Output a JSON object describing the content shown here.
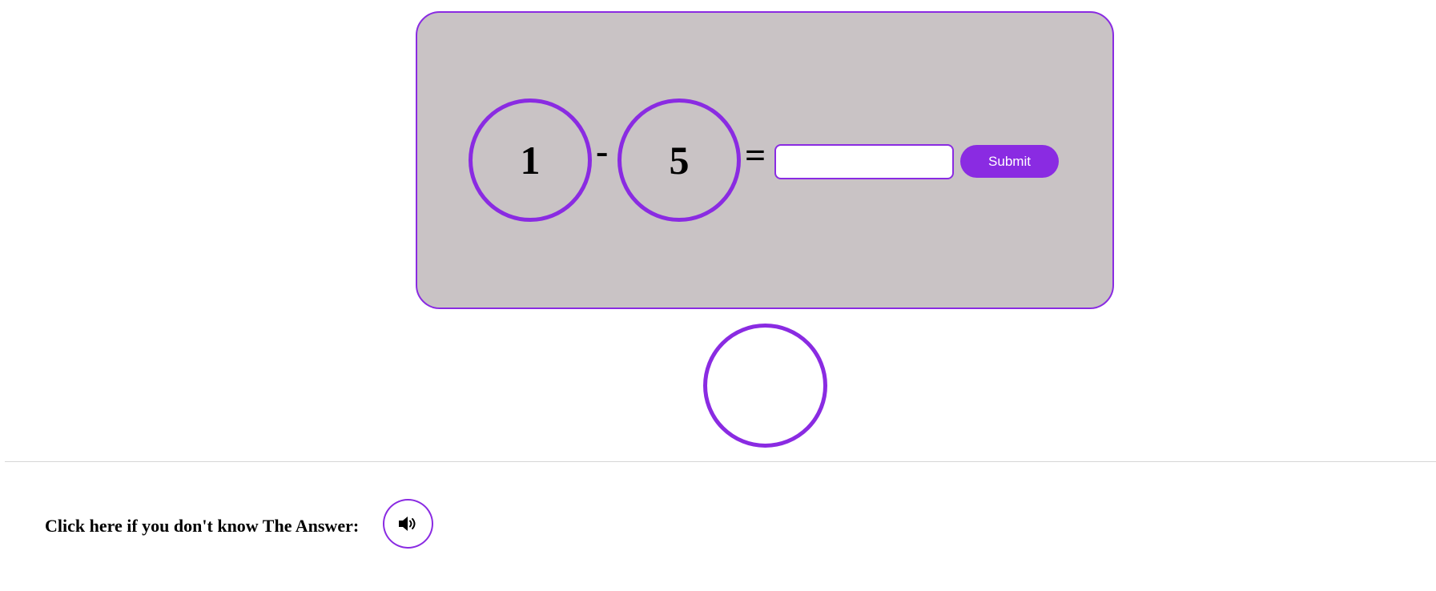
{
  "equation": {
    "operand_a": "1",
    "operator": "-",
    "operand_b": "5",
    "equals": "=",
    "answer_value": "",
    "answer_placeholder": ""
  },
  "submit": {
    "label": "Submit"
  },
  "help": {
    "label": "Click here if you don't know The Answer:",
    "icon": "speaker-icon"
  },
  "colors": {
    "accent": "#8a2be2",
    "panel_background": "#c9c3c5"
  }
}
